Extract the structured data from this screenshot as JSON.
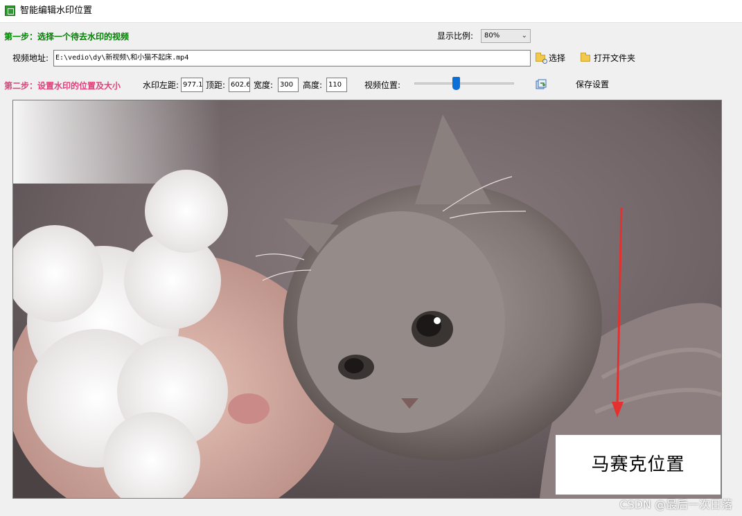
{
  "window": {
    "title": "智能编辑水印位置"
  },
  "step1": {
    "label": "第一步：选择一个待去水印的视频",
    "display_ratio_label": "显示比例:",
    "display_ratio_value": "80%",
    "video_path_label": "视频地址:",
    "video_path_value": "E:\\vedio\\dy\\新视频\\和小猫不起床.mp4",
    "select_button": "选择",
    "open_folder_button": "打开文件夹"
  },
  "step2": {
    "label": "第二步：设置水印的位置及大小",
    "left_label": "水印左距:",
    "left_value": "977.1",
    "top_label": "顶距:",
    "top_value": "602.6",
    "width_label": "宽度:",
    "width_value": "300",
    "height_label": "高度:",
    "height_value": "110",
    "video_position_label": "视频位置:",
    "video_position_fraction": 0.42,
    "save_button": "保存设置"
  },
  "preview": {
    "mosaic_label": "马赛克位置",
    "watermark": "CSDN @最后一次日落"
  },
  "colors": {
    "step1": "#008000",
    "step2": "#e0407a",
    "slider_thumb": "#0a6fd8",
    "arrow": "#e53030"
  },
  "icons": {
    "app": "app-icon",
    "select": "search-folder-icon",
    "open_folder": "folder-icon",
    "refresh": "refresh-icon"
  }
}
